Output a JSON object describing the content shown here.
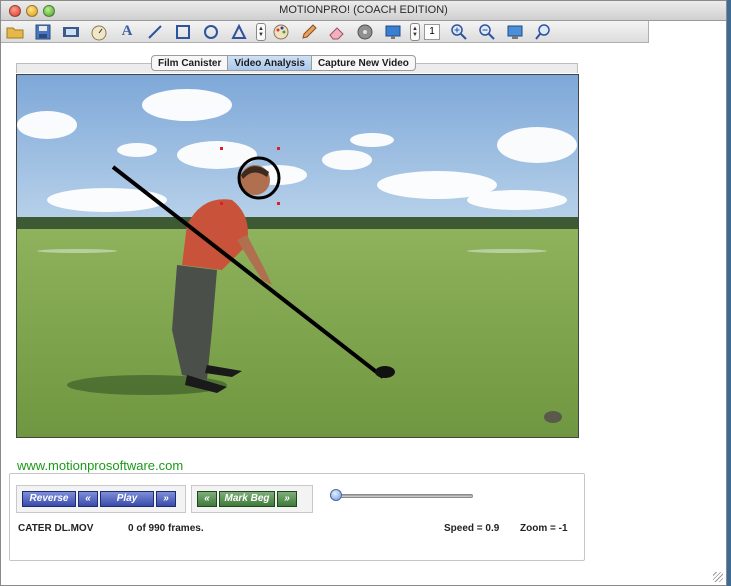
{
  "window": {
    "title": "MOTIONPRO! (COACH EDITION)"
  },
  "toolbar": {
    "items": [
      {
        "name": "open-folder-icon"
      },
      {
        "name": "save-disk-icon"
      },
      {
        "name": "film-strip-icon"
      },
      {
        "name": "stopwatch-icon"
      },
      {
        "name": "text-tool-icon",
        "glyph": "A"
      },
      {
        "name": "line-tool-icon"
      },
      {
        "name": "rectangle-tool-icon"
      },
      {
        "name": "circle-tool-icon"
      },
      {
        "name": "triangle-tool-icon"
      },
      {
        "name": "stepper-icon"
      },
      {
        "name": "palette-icon"
      },
      {
        "name": "pencil-icon"
      },
      {
        "name": "eraser-icon"
      },
      {
        "name": "reel-icon"
      },
      {
        "name": "monitor-icon"
      },
      {
        "name": "stepper-icon"
      },
      {
        "name": "frame-number-field",
        "value": "1"
      },
      {
        "name": "zoom-in-icon"
      },
      {
        "name": "zoom-out-icon"
      },
      {
        "name": "screen-capture-icon"
      },
      {
        "name": "search-icon"
      }
    ],
    "frame_value": "1"
  },
  "tabs": [
    {
      "label": "Film Canister",
      "active": false
    },
    {
      "label": "Video Analysis",
      "active": true
    },
    {
      "label": "Capture New Video",
      "active": false
    }
  ],
  "footer": {
    "website": "www.motionprosoftware.com"
  },
  "controls": {
    "reverse_label": "Reverse",
    "step_back_label": "«",
    "play_label": "Play",
    "step_fwd_label": "»",
    "mark_back_label": "«",
    "mark_beg_label": "Mark Beg",
    "mark_fwd_label": "»",
    "slider_position": 0
  },
  "status": {
    "filename": "CATER DL.MOV",
    "frames": "0 of 990 frames.",
    "speed": "Speed = 0.9",
    "zoom": "Zoom = -1"
  },
  "colors": {
    "website_green": "#1a9a1a",
    "tab_active": "#a9c8ec",
    "play_button_blue": "#3a4cac",
    "mark_button_green": "#3e7a3a"
  }
}
